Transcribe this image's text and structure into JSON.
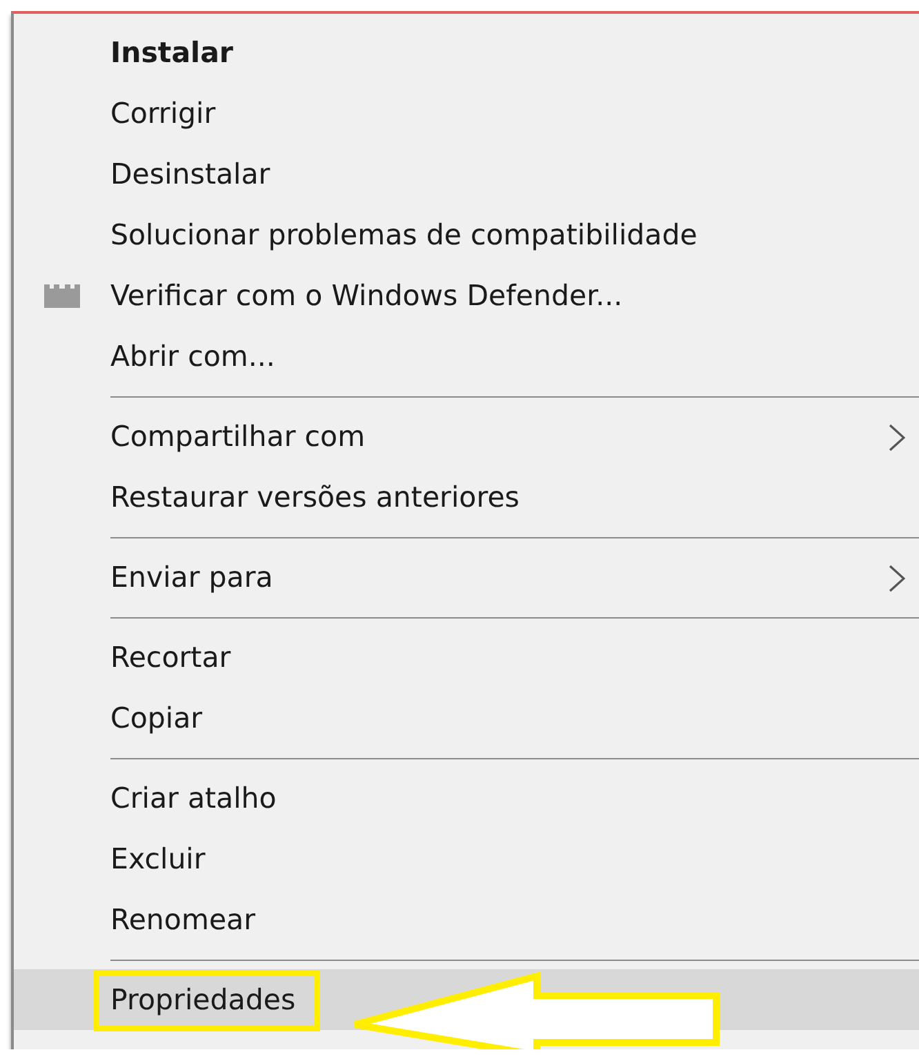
{
  "context_menu": {
    "items": [
      {
        "kind": "item",
        "label": "Instalar",
        "bold": true,
        "selected": false
      },
      {
        "kind": "item",
        "label": "Corrigir",
        "bold": false,
        "selected": false
      },
      {
        "kind": "item",
        "label": "Desinstalar",
        "bold": false,
        "selected": false
      },
      {
        "kind": "item",
        "label": "Solucionar problemas de compatibilidade",
        "bold": false,
        "selected": false
      },
      {
        "kind": "shield_item",
        "label": "Verificar com o Windows Defender...",
        "bold": false,
        "selected": false
      },
      {
        "kind": "item",
        "label": "Abrir com...",
        "bold": false,
        "selected": false
      },
      {
        "kind": "separator"
      },
      {
        "kind": "item",
        "label": "Compartilhar com",
        "bold": false,
        "selected": false,
        "submenu": true
      },
      {
        "kind": "item",
        "label": "Restaurar versões anteriores",
        "bold": false,
        "selected": false
      },
      {
        "kind": "separator"
      },
      {
        "kind": "item",
        "label": "Enviar para",
        "bold": false,
        "selected": false,
        "submenu": true
      },
      {
        "kind": "separator"
      },
      {
        "kind": "item",
        "label": "Recortar",
        "bold": false,
        "selected": false
      },
      {
        "kind": "item",
        "label": "Copiar",
        "bold": false,
        "selected": false
      },
      {
        "kind": "separator"
      },
      {
        "kind": "item",
        "label": "Criar atalho",
        "bold": false,
        "selected": false
      },
      {
        "kind": "item",
        "label": "Excluir",
        "bold": false,
        "selected": false
      },
      {
        "kind": "item",
        "label": "Renomear",
        "bold": false,
        "selected": false
      },
      {
        "kind": "separator"
      },
      {
        "kind": "item",
        "label": "Propriedades",
        "bold": false,
        "selected": true,
        "callout": true
      }
    ]
  }
}
